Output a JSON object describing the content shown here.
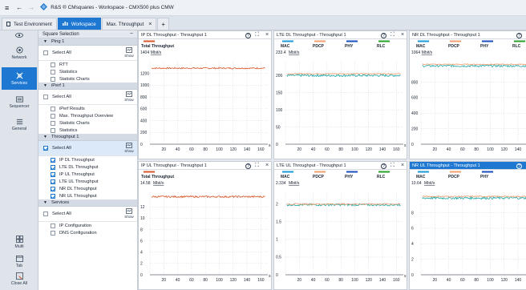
{
  "window": {
    "title": "R&S ® CMsquares - Workspace - CMX500 plus CMW"
  },
  "tabs": [
    {
      "label": "Test Environment",
      "icon": "document-icon",
      "active": false
    },
    {
      "label": "Workspace",
      "icon": "workspace-chart-icon",
      "active": true
    },
    {
      "label": "Max. Throughput",
      "icon": "",
      "active": false,
      "closable": true
    }
  ],
  "nav": [
    {
      "label": "Network",
      "icon": "network-icon",
      "selected": false
    },
    {
      "label": "Services",
      "icon": "services-icon",
      "selected": true
    },
    {
      "label": "Sequencer",
      "icon": "sequencer-icon",
      "selected": false
    },
    {
      "label": "General",
      "icon": "general-icon",
      "selected": false
    },
    {
      "label": "Multi",
      "icon": "multi-icon",
      "selected": false
    },
    {
      "label": "Tab",
      "icon": "tab-icon",
      "selected": false
    },
    {
      "label": "Close All",
      "icon": "close-all-icon",
      "selected": false
    }
  ],
  "sidebar": {
    "header": "Square Selection",
    "show_label": "Show",
    "sections": [
      {
        "name": "Ping 1",
        "select_all": "Select All",
        "select_all_checked": false,
        "items": [
          {
            "label": "RTT",
            "checked": false
          },
          {
            "label": "Statistics",
            "checked": false
          },
          {
            "label": "Statistic Charts",
            "checked": false
          }
        ]
      },
      {
        "name": "iPerf 1",
        "select_all": "Select All",
        "select_all_checked": false,
        "items": [
          {
            "label": "iPerf Results",
            "checked": false
          },
          {
            "label": "Max. Throughput Overview",
            "checked": false
          },
          {
            "label": "Statistic Charts",
            "checked": false
          },
          {
            "label": "Statistics",
            "checked": false
          }
        ]
      },
      {
        "name": "Throughput 1",
        "select_all": "Select All",
        "select_all_checked": true,
        "items": [
          {
            "label": "IP DL Throughput",
            "checked": true
          },
          {
            "label": "LTE DL Throughput",
            "checked": true
          },
          {
            "label": "IP UL Throughput",
            "checked": true
          },
          {
            "label": "LTE UL Throughput",
            "checked": true
          },
          {
            "label": "NR DL Throughput",
            "checked": true
          },
          {
            "label": "NR UL Throughput",
            "checked": true
          }
        ]
      },
      {
        "name": "Services",
        "select_all": "Select All",
        "select_all_checked": false,
        "items": [
          {
            "label": "IP Configuration",
            "checked": false
          },
          {
            "label": "DNS Configuration",
            "checked": false
          }
        ]
      }
    ]
  },
  "colors": {
    "accent": "#1e78d2",
    "mac": "#1a9bd7",
    "pdcp": "#f0a070",
    "phy": "#1a4fbf",
    "rlc": "#2aa02a",
    "total": "#d9572b",
    "line_main": "#20a8a8",
    "line_total": "#d9572b"
  },
  "panel_controls": {
    "help": "?",
    "expand": "⛶",
    "close": "×"
  },
  "chart_data": [
    {
      "type": "line",
      "title": "IP DL Throughput - Throughput 1",
      "selected": false,
      "legend": [
        "Total Throughput"
      ],
      "unit": "Mbit/s",
      "current_value": "1404",
      "x_unit": "s",
      "xlim": [
        0,
        170
      ],
      "xticks": [
        0,
        20,
        40,
        60,
        80,
        100,
        120,
        140,
        160
      ],
      "ylim": [
        0,
        1400
      ],
      "yticks": [
        0,
        200,
        400,
        600,
        800,
        1000,
        1200
      ],
      "series": [
        {
          "name": "Total Throughput",
          "color": "#d9572b",
          "level": 1290,
          "noise": 12
        }
      ]
    },
    {
      "type": "line",
      "title": "LTE DL Throughput - Throughput 1",
      "selected": false,
      "legend": [
        "MAC",
        "PDCP",
        "PHY",
        "RLC"
      ],
      "unit": "Mbit/s",
      "current_value": "233.4",
      "x_unit": "s",
      "xlim": [
        0,
        170
      ],
      "xticks": [
        0,
        20,
        40,
        60,
        80,
        100,
        120,
        140,
        160
      ],
      "ylim": [
        0,
        240
      ],
      "yticks": [
        0,
        50,
        100,
        150,
        200
      ],
      "series": [
        {
          "name": "MAC",
          "color": "#20a8a8",
          "level": 200,
          "noise": 3.5
        },
        {
          "name": "PDCP",
          "color": "#f0a070",
          "level": 205,
          "noise": 1.5
        }
      ]
    },
    {
      "type": "line",
      "title": "NR DL Throughput - Throughput 1",
      "selected": false,
      "legend": [
        "MAC",
        "PDCP",
        "PHY",
        "RLC"
      ],
      "unit": "Mbit/s",
      "current_value": "1064",
      "x_unit": "s",
      "xlim": [
        0,
        170
      ],
      "xticks": [
        0,
        20,
        40,
        60,
        80,
        100,
        120,
        140,
        160
      ],
      "ylim": [
        0,
        1064
      ],
      "yticks": [
        0,
        200,
        400,
        600,
        800
      ],
      "series": [
        {
          "name": "MAC",
          "color": "#20a8a8",
          "level": 1010,
          "noise": 14
        },
        {
          "name": "PDCP",
          "color": "#f0a070",
          "level": 1030,
          "noise": 6
        }
      ]
    },
    {
      "type": "line",
      "title": "IP UL Throughput - Throughput 1",
      "selected": false,
      "legend": [
        "Total Throughput"
      ],
      "unit": "Mbit/s",
      "current_value": "14.58",
      "x_unit": "s",
      "xlim": [
        0,
        170
      ],
      "xticks": [
        0,
        20,
        40,
        60,
        80,
        100,
        120,
        140,
        160
      ],
      "ylim": [
        0,
        14.58
      ],
      "yticks": [
        0,
        2,
        4,
        6,
        8,
        10,
        12
      ],
      "series": [
        {
          "name": "Total Throughput",
          "color": "#d9572b",
          "level": 13.8,
          "noise": 0.15
        }
      ]
    },
    {
      "type": "line",
      "title": "LTE UL Throughput - Throughput 1",
      "selected": false,
      "legend": [
        "MAC",
        "PDCP",
        "PHY",
        "RLC"
      ],
      "unit": "Mbit/s",
      "current_value": "2.334",
      "x_unit": "s",
      "xlim": [
        0,
        170
      ],
      "xticks": [
        0,
        20,
        40,
        60,
        80,
        100,
        120,
        140,
        160
      ],
      "ylim": [
        0,
        2.334
      ],
      "yticks": [
        0,
        0.5,
        1,
        1.5,
        2
      ],
      "series": [
        {
          "name": "MAC",
          "color": "#20a8a8",
          "level": 1.98,
          "noise": 0.03
        },
        {
          "name": "PDCP",
          "color": "#f0a070",
          "level": 2.0,
          "noise": 0.02
        }
      ]
    },
    {
      "type": "line",
      "title": "NR UL Throughput - Throughput 1",
      "selected": true,
      "legend": [
        "MAC",
        "PDCP",
        "PHY"
      ],
      "unit": "Mbit/s",
      "current_value": "10.64",
      "x_unit": "s",
      "xlim": [
        0,
        170
      ],
      "xticks": [
        0,
        20,
        40,
        60,
        80,
        100,
        120,
        140,
        160
      ],
      "ylim": [
        0,
        10.64
      ],
      "yticks": [
        0,
        2,
        4,
        6,
        8
      ],
      "series": [
        {
          "name": "MAC",
          "color": "#20a8a8",
          "level": 9.9,
          "noise": 0.15
        },
        {
          "name": "PDCP",
          "color": "#f0a070",
          "level": 10.1,
          "noise": 0.08
        }
      ]
    }
  ]
}
